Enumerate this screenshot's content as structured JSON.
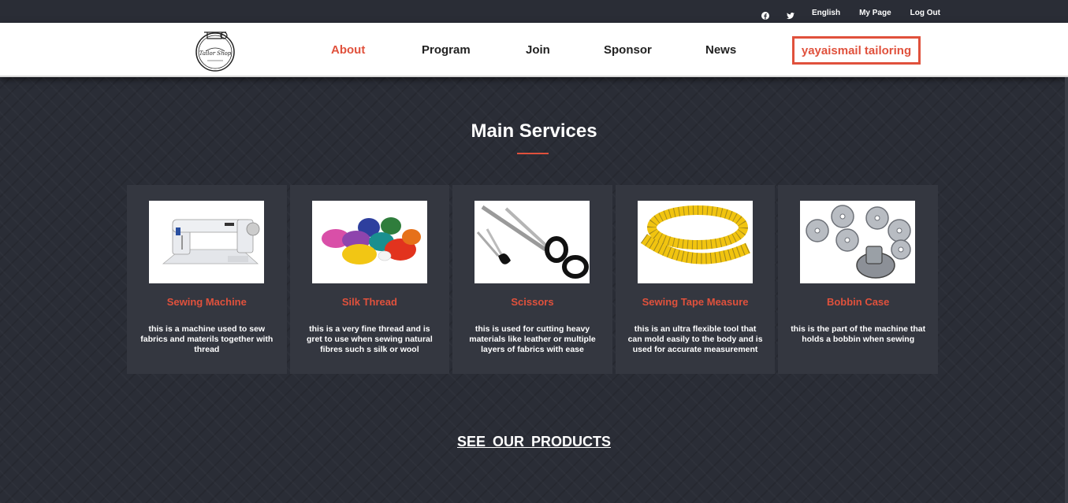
{
  "topbar": {
    "icons": [
      "facebook-icon",
      "twitter-icon"
    ],
    "links": [
      "English",
      "My Page",
      "Log Out"
    ]
  },
  "header": {
    "logo_text": "Tailor Shop",
    "nav": [
      "About",
      "Program",
      "Join",
      "Sponsor",
      "News"
    ],
    "active": "About",
    "cta": "yayaismail tailoring"
  },
  "main": {
    "title": "Main Services",
    "cards": [
      {
        "title": "Sewing Machine",
        "desc": "this is a machine used to sew fabrics and materils together with thread",
        "image": "sewing-machine-image"
      },
      {
        "title": "Silk Thread",
        "desc": "this is a very fine thread and is gret to use when sewing natural fibres such s silk or wool",
        "image": "silk-thread-image"
      },
      {
        "title": "Scissors",
        "desc": "this is used for cutting heavy materials like leather or multiple layers of fabrics with ease",
        "image": "scissors-image"
      },
      {
        "title": "Sewing Tape Measure",
        "desc": "this is an ultra flexible tool that can mold easily to the body and is used for accurate measurement",
        "image": "tape-measure-image"
      },
      {
        "title": "Bobbin Case",
        "desc": "this is the part of the machine that holds a bobbin when sewing",
        "image": "bobbin-case-image"
      }
    ],
    "products_link": "SEE OUR PRODUCTS"
  },
  "colors": {
    "accent": "#e0513c",
    "background": "#2a2d36",
    "card": "#343740"
  }
}
